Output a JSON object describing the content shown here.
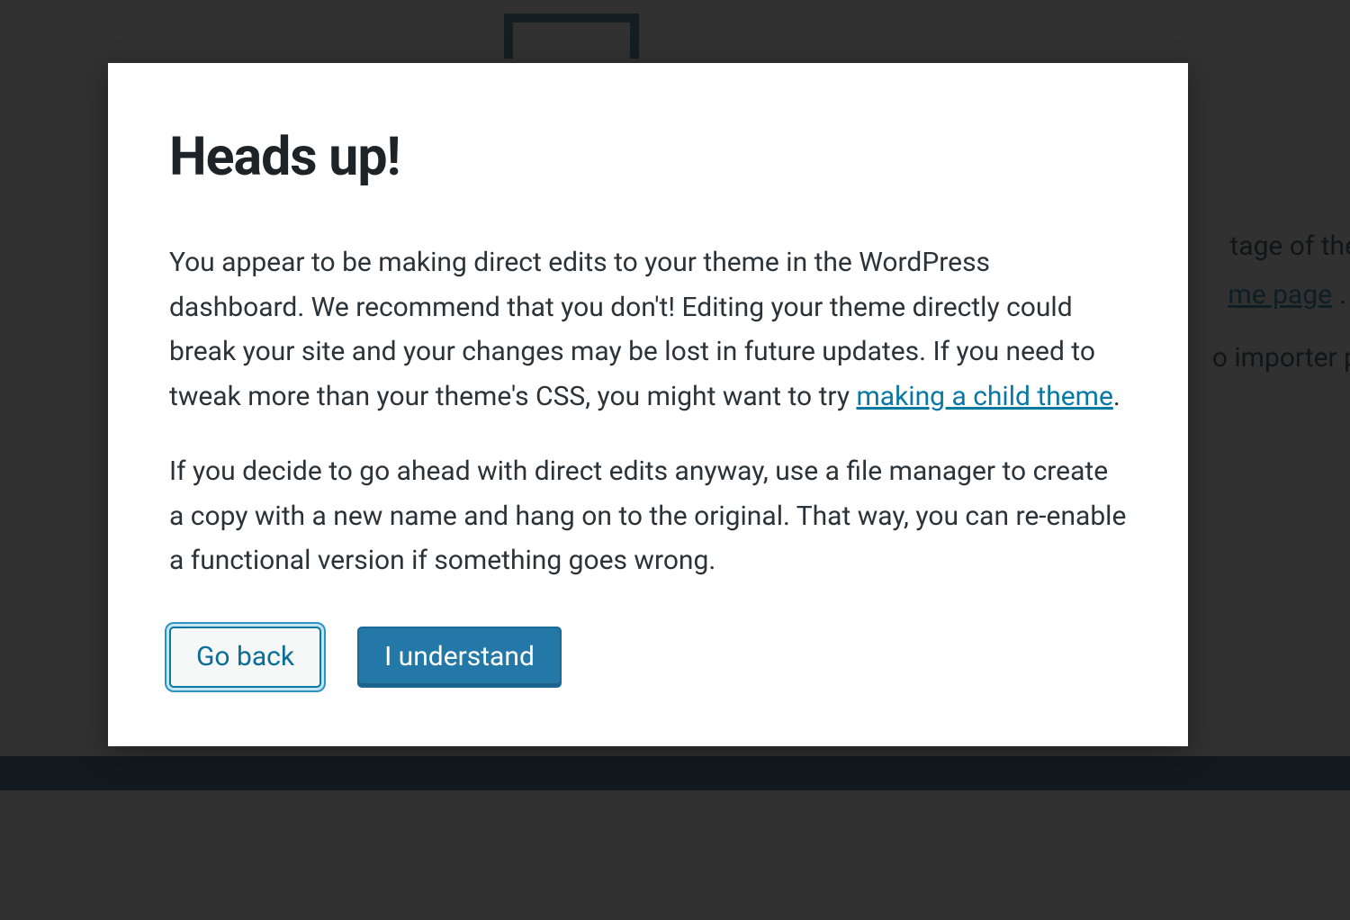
{
  "background": {
    "text_fragment_1": "tage of the",
    "link_fragment": "me page",
    "period": ".",
    "text_fragment_2": "o importer p"
  },
  "modal": {
    "title": "Heads up!",
    "paragraph1_prefix": "You appear to be making direct edits to your theme in the WordPress dashboard. We recommend that you don't! Editing your theme directly could break your site and your changes may be lost in future updates. If you need to tweak more than your theme's CSS, you might want to try ",
    "paragraph1_link": "making a child theme",
    "paragraph1_suffix": ".",
    "paragraph2": "If you decide to go ahead with direct edits anyway, use a file manager to create a copy with a new name and hang on to the original. That way, you can re-enable a functional version if something goes wrong.",
    "buttons": {
      "go_back": "Go back",
      "understand": "I understand"
    }
  }
}
